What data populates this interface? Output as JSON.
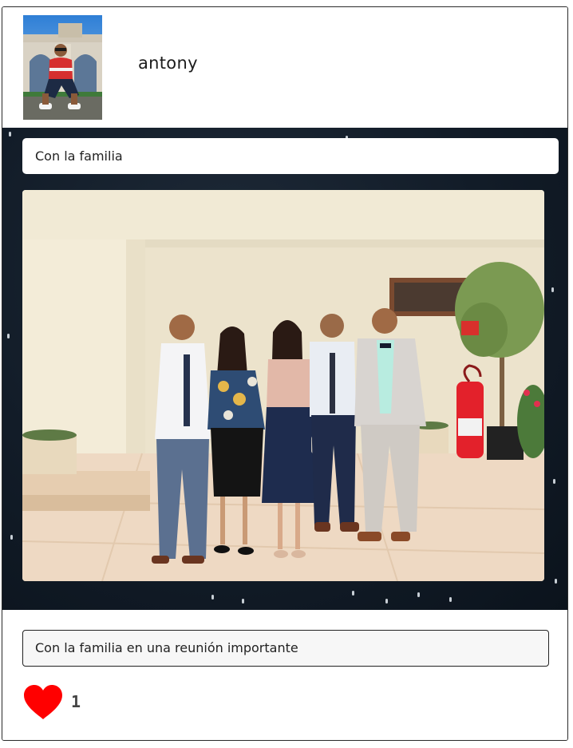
{
  "post": {
    "user": {
      "username": "antony",
      "avatar_icon": "user-avatar-photo"
    },
    "title": "Con la familia",
    "photo_icon": "family-group-photo",
    "description": "Con la familia en una reunión importante",
    "likes": {
      "icon": "heart-icon",
      "color": "#ff0000",
      "count": "1"
    }
  },
  "colors": {
    "panel_background": "#121c28",
    "card_border": "#2a2a2a",
    "like": "#ff0000"
  }
}
